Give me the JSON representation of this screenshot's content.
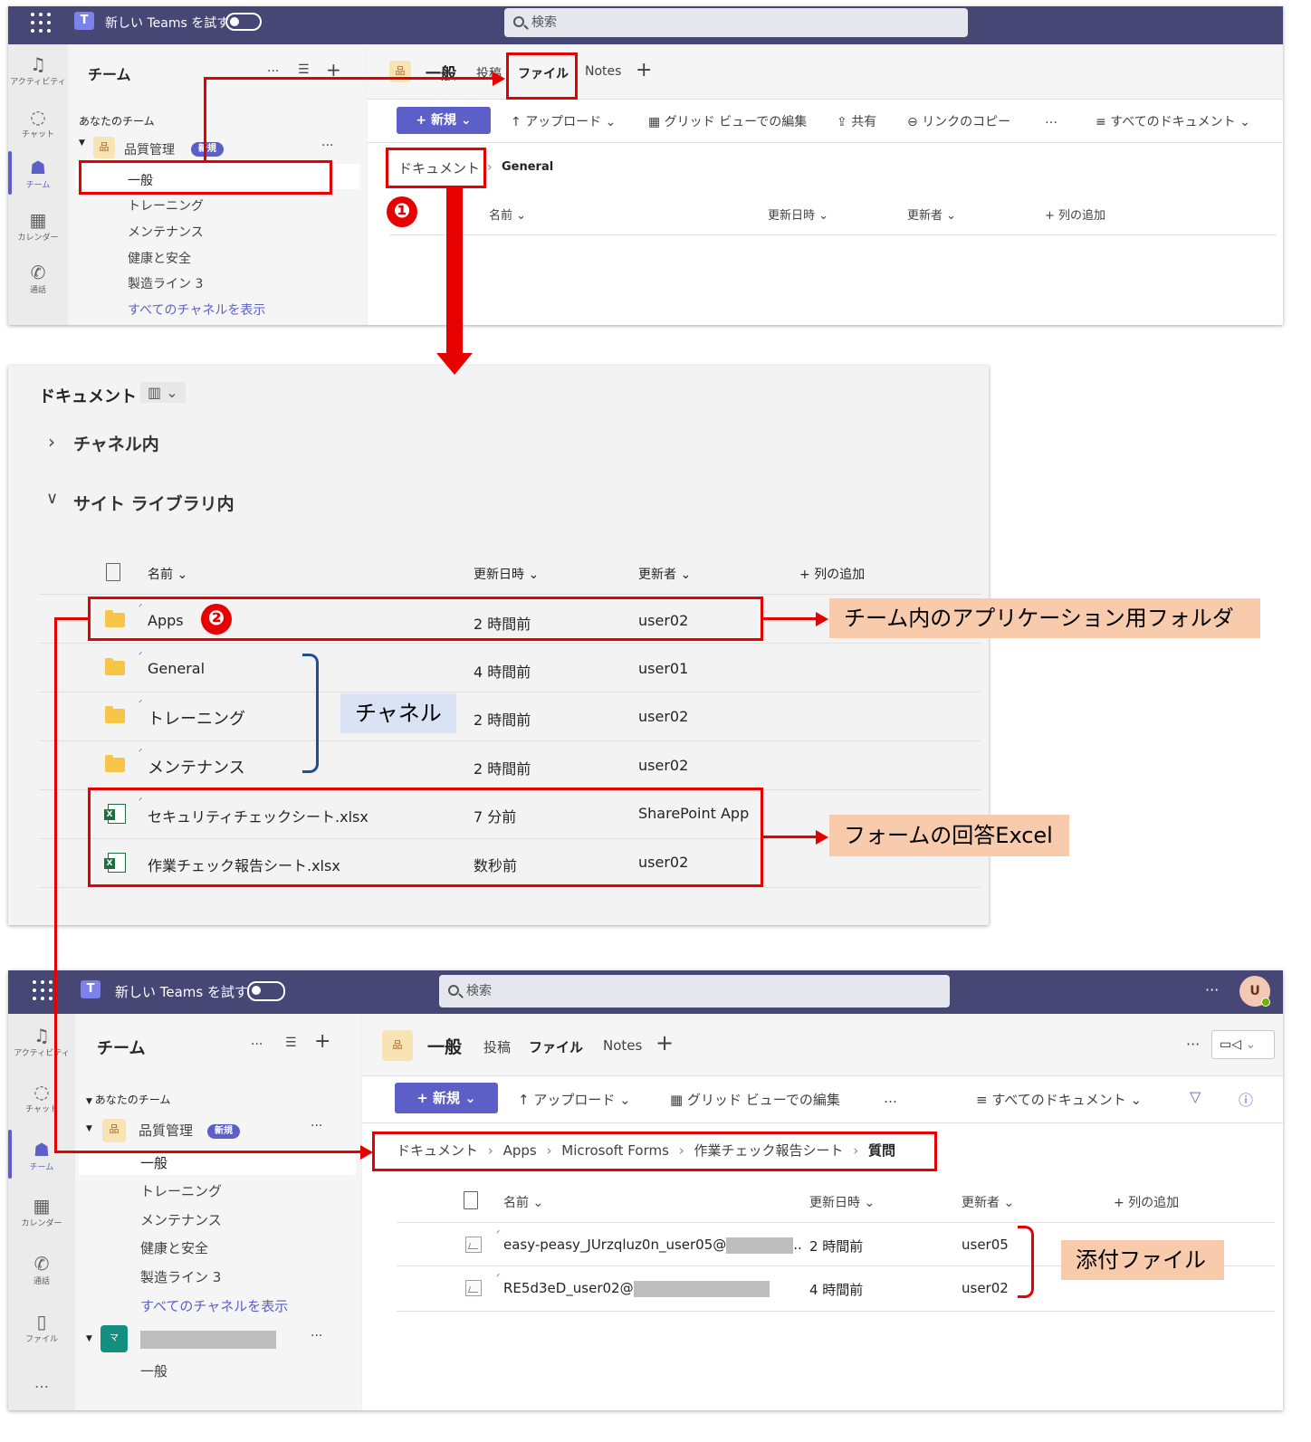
{
  "screens": {
    "top_bar": {
      "try_new_teams": "新しい Teams を試す",
      "search_placeholder": "検索"
    },
    "rail": {
      "activity": "アクティビティ",
      "chat": "チャット",
      "teams": "チーム",
      "calendar": "カレンダー",
      "calls": "通話",
      "files": "ファイル",
      "more": "…"
    },
    "teams_panel": {
      "title": "チーム",
      "your_teams": "あなたのチーム",
      "team_name": "品質管理",
      "badge_new": "新規",
      "team_icon": "品",
      "channels": [
        "一般",
        "トレーニング",
        "メンテナンス",
        "健康と安全",
        "製造ライン 3"
      ],
      "show_all_channels": "すべてのチャネルを表示",
      "second_team_icon": "マ",
      "second_team_channel": "一般"
    },
    "channel_header": {
      "channel_icon": "品",
      "channel_name": "一般",
      "tab_posts": "投稿",
      "tab_files": "ファイル",
      "tab_notes": "Notes",
      "add_tab": "+"
    },
    "toolbar": {
      "new": "新規",
      "upload": "アップロード",
      "grid_edit": "グリッド ビューでの編集",
      "share": "共有",
      "copy_link": "リンクのコピー",
      "more": "…",
      "all_docs": "すべてのドキュメント"
    },
    "breadcrumb_1": [
      "ドキュメント",
      "General"
    ],
    "columns": {
      "name": "名前",
      "modified": "更新日時",
      "modified_by": "更新者",
      "add_column": "+ 列の追加"
    }
  },
  "library_view": {
    "title": "ドキュメント",
    "section_channel": "チャネル内",
    "section_site": "サイト ライブラリ内",
    "rows": [
      {
        "name": "Apps",
        "modified": "2 時間前",
        "by": "user02",
        "type": "folder"
      },
      {
        "name": "General",
        "modified": "4 時間前",
        "by": "user01",
        "type": "folder"
      },
      {
        "name": "トレーニング",
        "modified": "2 時間前",
        "by": "user02",
        "type": "folder"
      },
      {
        "name": "メンテナンス",
        "modified": "2 時間前",
        "by": "user02",
        "type": "folder"
      },
      {
        "name": "セキュリティチェックシート.xlsx",
        "modified": "7 分前",
        "by": "SharePoint App",
        "type": "excel"
      },
      {
        "name": "作業チェック報告シート.xlsx",
        "modified": "数秒前",
        "by": "user02",
        "type": "excel"
      }
    ]
  },
  "bottom_view": {
    "avatar": "U",
    "breadcrumb": [
      "ドキュメント",
      "Apps",
      "Microsoft Forms",
      "作業チェック報告シート",
      "質問"
    ],
    "rows": [
      {
        "name": "easy-peasy_JUrzqluz0n_user05@",
        "suffix": "..",
        "modified": "2 時間前",
        "by": "user05"
      },
      {
        "name": "RE5d3eD_user02@",
        "suffix": "",
        "modified": "4 時間前",
        "by": "user02"
      }
    ]
  },
  "annotations": {
    "step1": "❶",
    "step2": "❷",
    "apps_folder": "チーム内のアプリケーション用フォルダ",
    "channels": "チャネル",
    "form_excel": "フォームの回答Excel",
    "attachments": "添付ファイル"
  },
  "colors": {
    "teams_purple": "#5b5fc7",
    "topbar": "#464775",
    "red": "#e60000",
    "callout_orange": "#f8cbad",
    "callout_blue": "#dae3f3",
    "brace_blue": "#1f4e99"
  }
}
